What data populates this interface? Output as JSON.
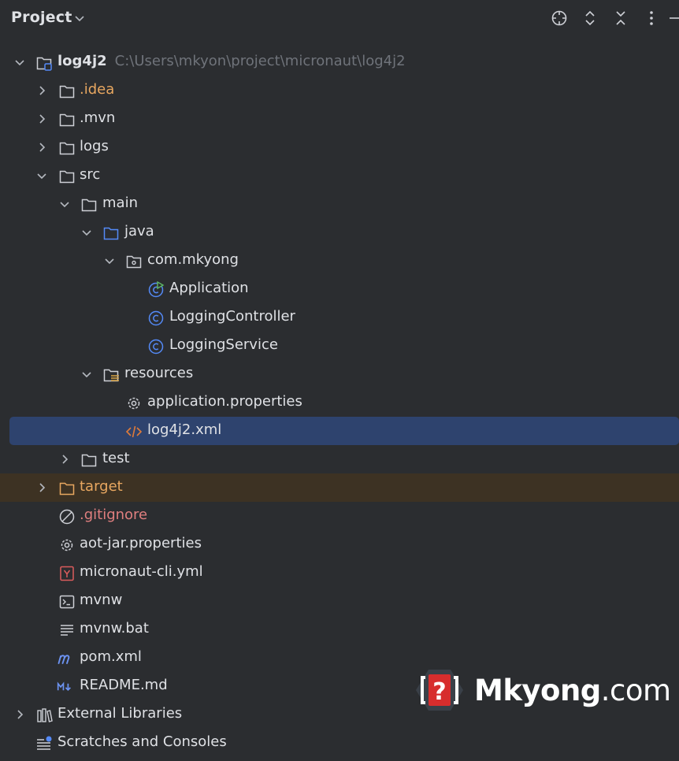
{
  "header": {
    "title": "Project",
    "actions": [
      "locate-icon",
      "expand-collapse-icon",
      "collapse-all-icon",
      "more-options-icon",
      "hide-icon"
    ]
  },
  "colors": {
    "background": "#2b2d30",
    "selection": "#2e436e",
    "excluded_bg": "#3d3223",
    "orange_text": "#e8a760",
    "red_text": "#e07f7f",
    "path_text": "#6f737a",
    "class_icon": "#548af7",
    "xml_icon": "#e07b39"
  },
  "tree": [
    {
      "label": "log4j2",
      "path": "C:\\Users\\mkyon\\project\\micronaut\\log4j2",
      "icon": "module-folder-icon",
      "expanded": true
    },
    {
      "label": ".idea",
      "icon": "folder-icon",
      "expanded": false
    },
    {
      "label": ".mvn",
      "icon": "folder-icon",
      "expanded": false
    },
    {
      "label": "logs",
      "icon": "folder-icon",
      "expanded": false
    },
    {
      "label": "src",
      "icon": "folder-icon",
      "expanded": true
    },
    {
      "label": "main",
      "icon": "folder-icon",
      "expanded": true
    },
    {
      "label": "java",
      "icon": "source-folder-icon",
      "expanded": true
    },
    {
      "label": "com.mkyong",
      "icon": "package-icon",
      "expanded": true
    },
    {
      "label": "Application",
      "icon": "runnable-class-icon"
    },
    {
      "label": "LoggingController",
      "icon": "class-icon"
    },
    {
      "label": "LoggingService",
      "icon": "class-icon"
    },
    {
      "label": "resources",
      "icon": "resources-folder-icon",
      "expanded": true
    },
    {
      "label": "application.properties",
      "icon": "properties-gear-icon"
    },
    {
      "label": "log4j2.xml",
      "icon": "xml-icon",
      "selected": true
    },
    {
      "label": "test",
      "icon": "folder-icon",
      "expanded": false
    },
    {
      "label": "target",
      "icon": "excluded-folder-icon",
      "expanded": false
    },
    {
      "label": ".gitignore",
      "icon": "ignore-icon"
    },
    {
      "label": "aot-jar.properties",
      "icon": "properties-gear-icon"
    },
    {
      "label": "micronaut-cli.yml",
      "icon": "yaml-icon"
    },
    {
      "label": "mvnw",
      "icon": "shell-script-icon"
    },
    {
      "label": "mvnw.bat",
      "icon": "text-file-icon"
    },
    {
      "label": "pom.xml",
      "icon": "maven-icon"
    },
    {
      "label": "README.md",
      "icon": "markdown-icon"
    },
    {
      "label": "External Libraries",
      "icon": "libraries-icon",
      "expanded": false
    },
    {
      "label": "Scratches and Consoles",
      "icon": "scratches-icon"
    }
  ],
  "watermark": {
    "brand": "Mkyong",
    "suffix": ".com",
    "logo_glyph": "?"
  }
}
